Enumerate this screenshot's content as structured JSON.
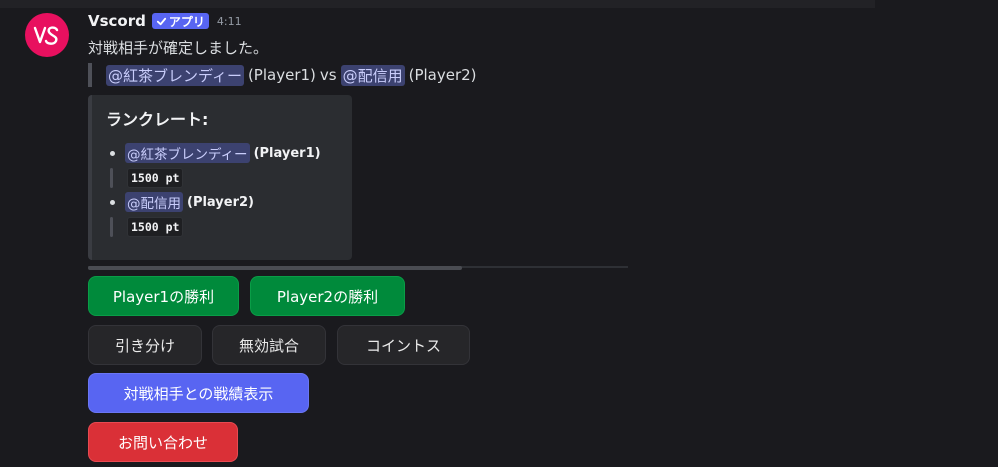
{
  "message": {
    "username": "Vscord",
    "badge": "アプリ",
    "timestamp": "4:11",
    "avatar_text": "VS",
    "content": "対戦相手が確定しました。",
    "quote": {
      "player1_mention": "@紅茶ブレンディー",
      "player1_tag": "(Player1)",
      "vs": "vs",
      "player2_mention": "@配信用",
      "player2_tag": "(Player2)"
    }
  },
  "embed": {
    "title": "ランクレート:",
    "entries": [
      {
        "mention": "@紅茶ブレンディー",
        "tag": "(Player1)",
        "rate": "1500 pt"
      },
      {
        "mention": "@配信用",
        "tag": "(Player2)",
        "rate": "1500 pt"
      }
    ]
  },
  "buttons": {
    "player1_win": "Player1の勝利",
    "player2_win": "Player2の勝利",
    "draw": "引き分け",
    "no_contest": "無効試合",
    "coin_toss": "コイントス",
    "record": "対戦相手との戦績表示",
    "contact": "お問い合わせ"
  },
  "colors": {
    "avatar": "#e8105f",
    "green": "#008a3b",
    "grey": "#262629",
    "blurple": "#5865f2",
    "red": "#da3037"
  }
}
